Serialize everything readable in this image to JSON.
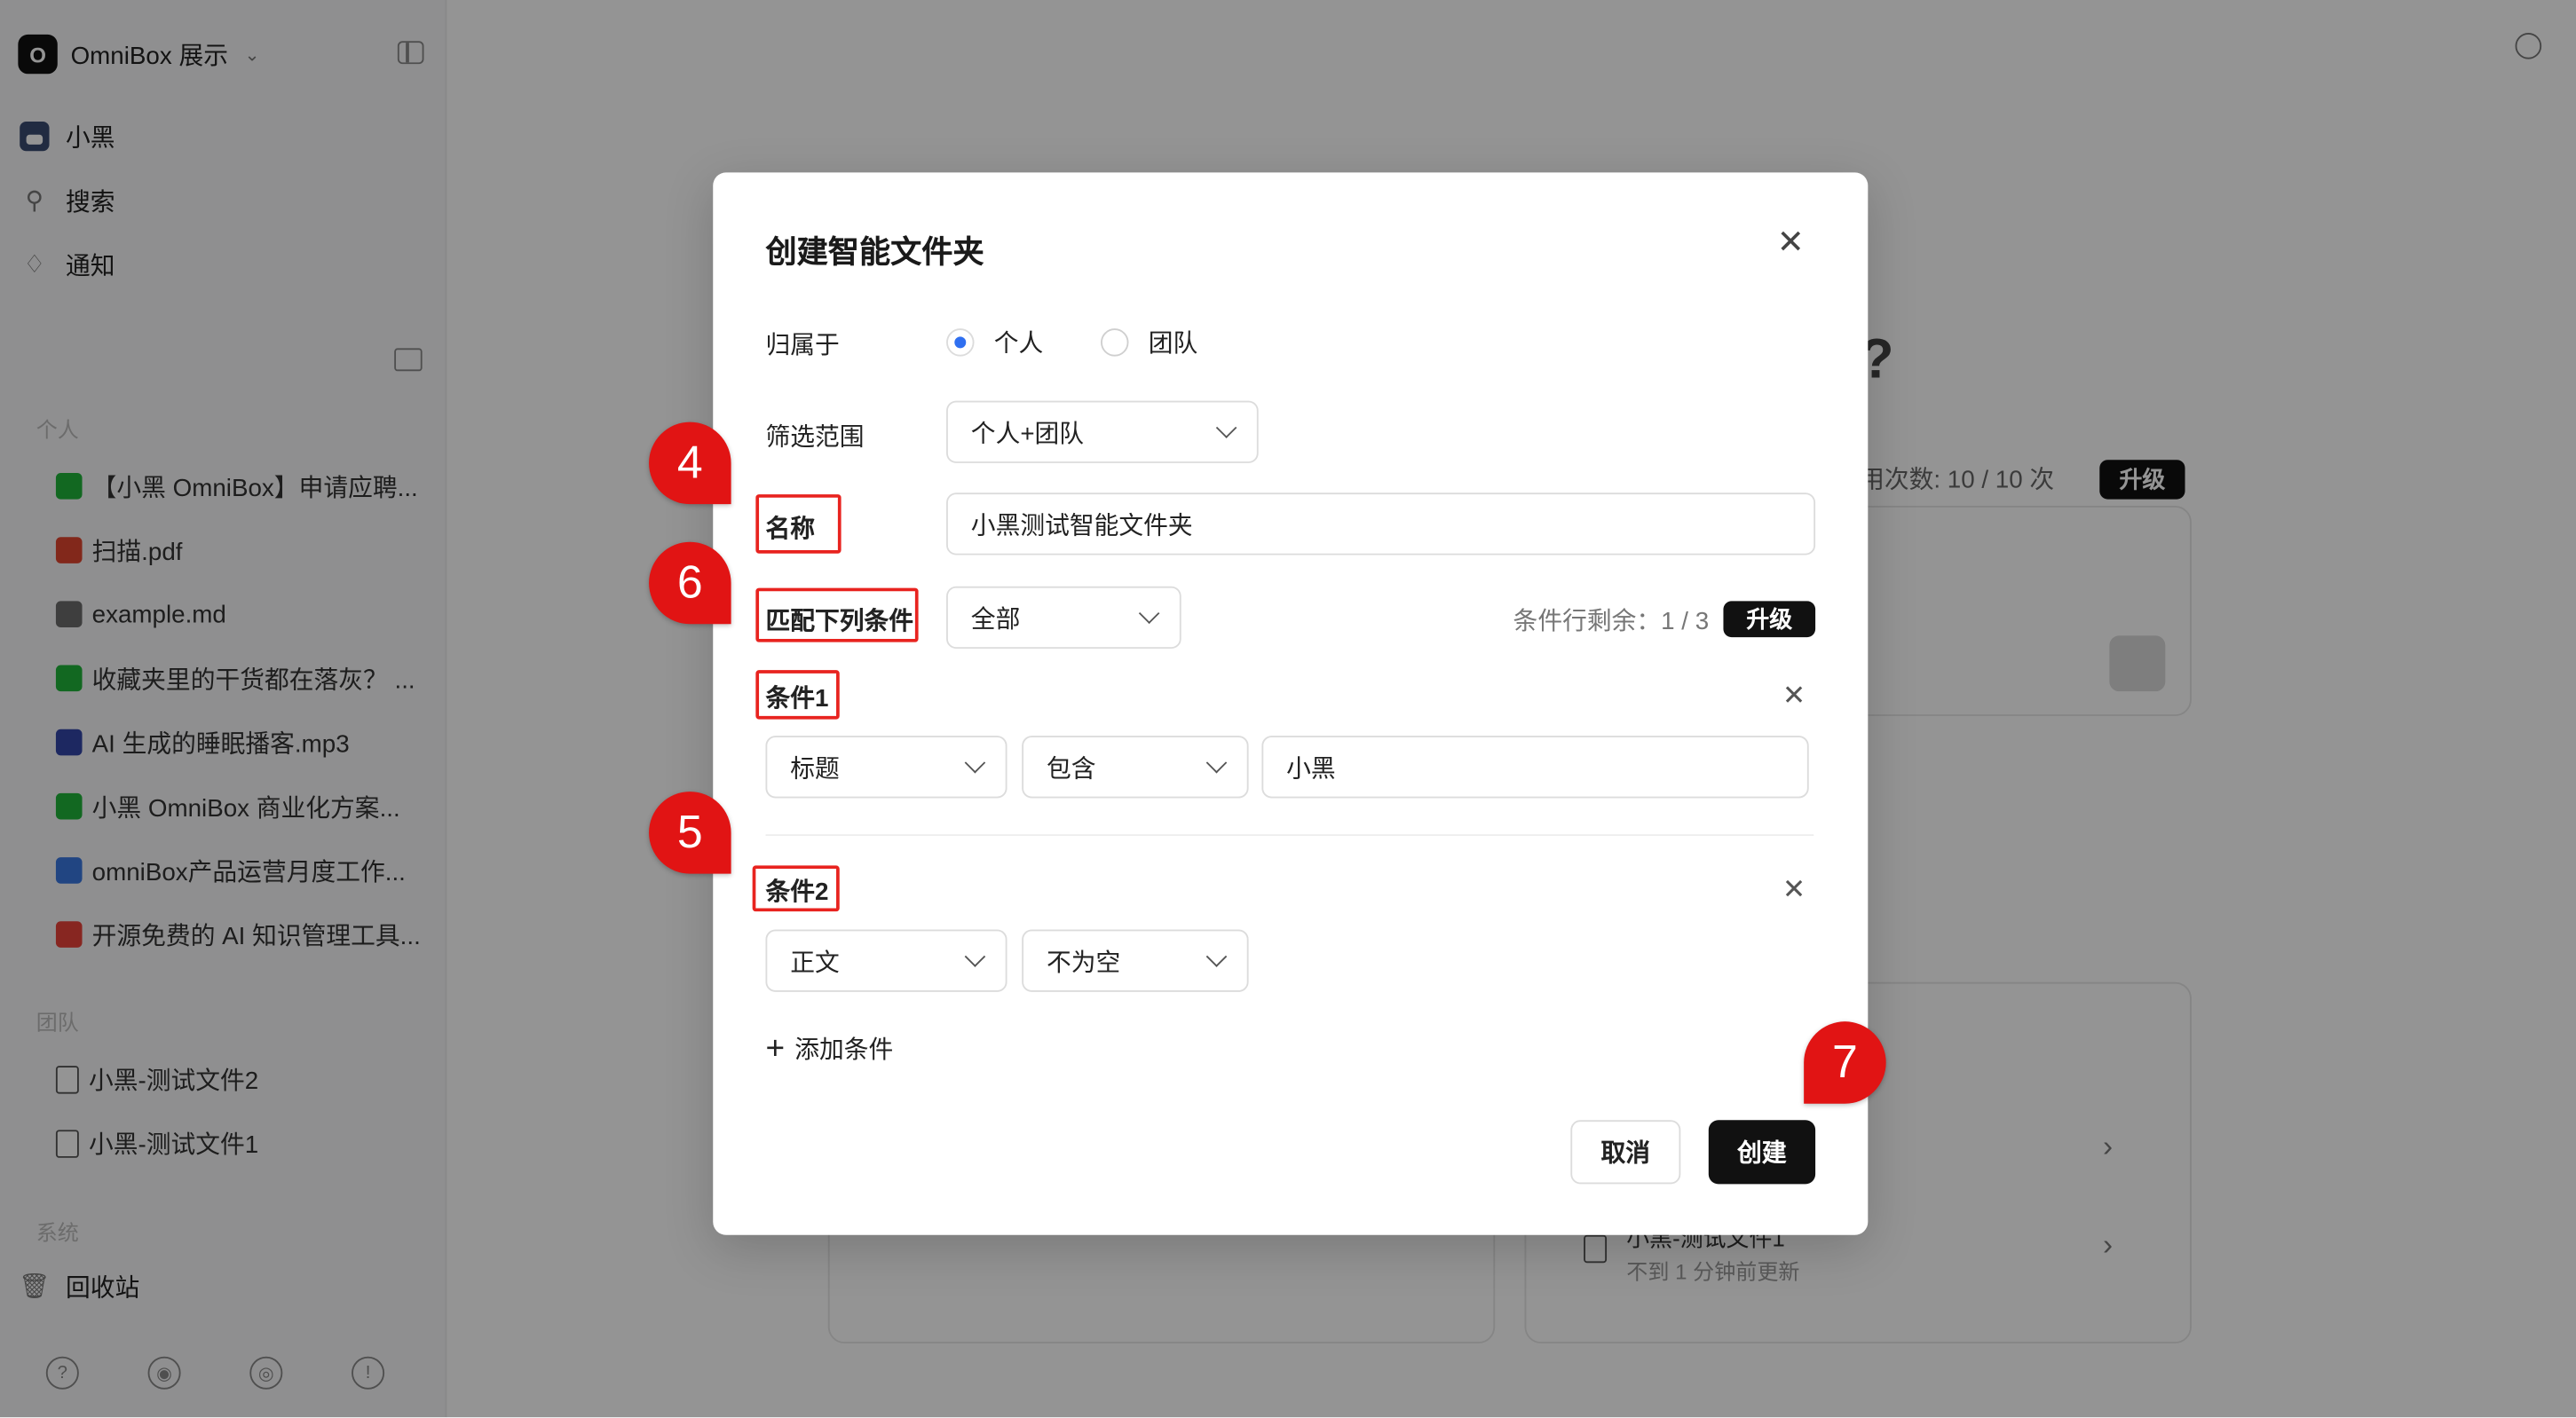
{
  "sidebar": {
    "workspace": {
      "logo_letter": "O",
      "name": "OmniBox 展示"
    },
    "nav": [
      {
        "label": "小黑",
        "icon": "user-avatar-icon"
      },
      {
        "label": "搜索",
        "icon": "search-icon"
      },
      {
        "label": "通知",
        "icon": "bell-icon"
      }
    ],
    "personal_label": "个人",
    "personal_items": [
      {
        "label": "【小黑 OmniBox】申请应聘...",
        "icon": "wechat-icon"
      },
      {
        "label": "扫描.pdf",
        "icon": "pdf-icon"
      },
      {
        "label": "example.md",
        "icon": "markdown-icon"
      },
      {
        "label": "收藏夹里的干货都在落灰？ ...",
        "icon": "wechat-icon"
      },
      {
        "label": "AI 生成的睡眠播客.mp3",
        "icon": "audio-icon"
      },
      {
        "label": "小黑 OmniBox 商业化方案...",
        "icon": "wechat-icon"
      },
      {
        "label": "omniBox产品运营月度工作...",
        "icon": "word-icon"
      },
      {
        "label": "开源免费的 AI 知识管理工具...",
        "icon": "web-icon"
      }
    ],
    "team_label": "团队",
    "team_items": [
      {
        "label": "小黑-测试文件2",
        "icon": "document-icon"
      },
      {
        "label": "小黑-测试文件1",
        "icon": "document-icon"
      }
    ],
    "system_label": "系统",
    "trash_label": "回收站"
  },
  "background": {
    "question_mark": "?",
    "usage_text": "用次数: 10 / 10 次",
    "upgrade_label": "升级",
    "doc_title": "小黑-测试文件1",
    "doc_updated": "不到 1 分钟前更新"
  },
  "dialog": {
    "title": "创建智能文件夹",
    "owner_label": "归属于",
    "owner_options": [
      "个人",
      "团队"
    ],
    "owner_selected": "个人",
    "scope_label": "筛选范围",
    "scope_value": "个人+团队",
    "name_label": "名称",
    "name_value": "小黑测试智能文件夹",
    "match_label": "匹配下列条件",
    "match_value": "全部",
    "remaining_text": "条件行剩余：1 / 3",
    "upgrade_label": "升级",
    "conditions": [
      {
        "label": "条件1",
        "field": "标题",
        "operator": "包含",
        "value": "小黑"
      },
      {
        "label": "条件2",
        "field": "正文",
        "operator": "不为空"
      }
    ],
    "add_condition_label": "添加条件",
    "cancel_label": "取消",
    "create_label": "创建"
  },
  "annotations": {
    "steps": [
      "4",
      "6",
      "5",
      "7"
    ],
    "highlight_color": "#e8231f",
    "marker_color": "#e11414"
  },
  "colors": {
    "accent": "#2f6ff0",
    "primary_button": "#111111"
  }
}
